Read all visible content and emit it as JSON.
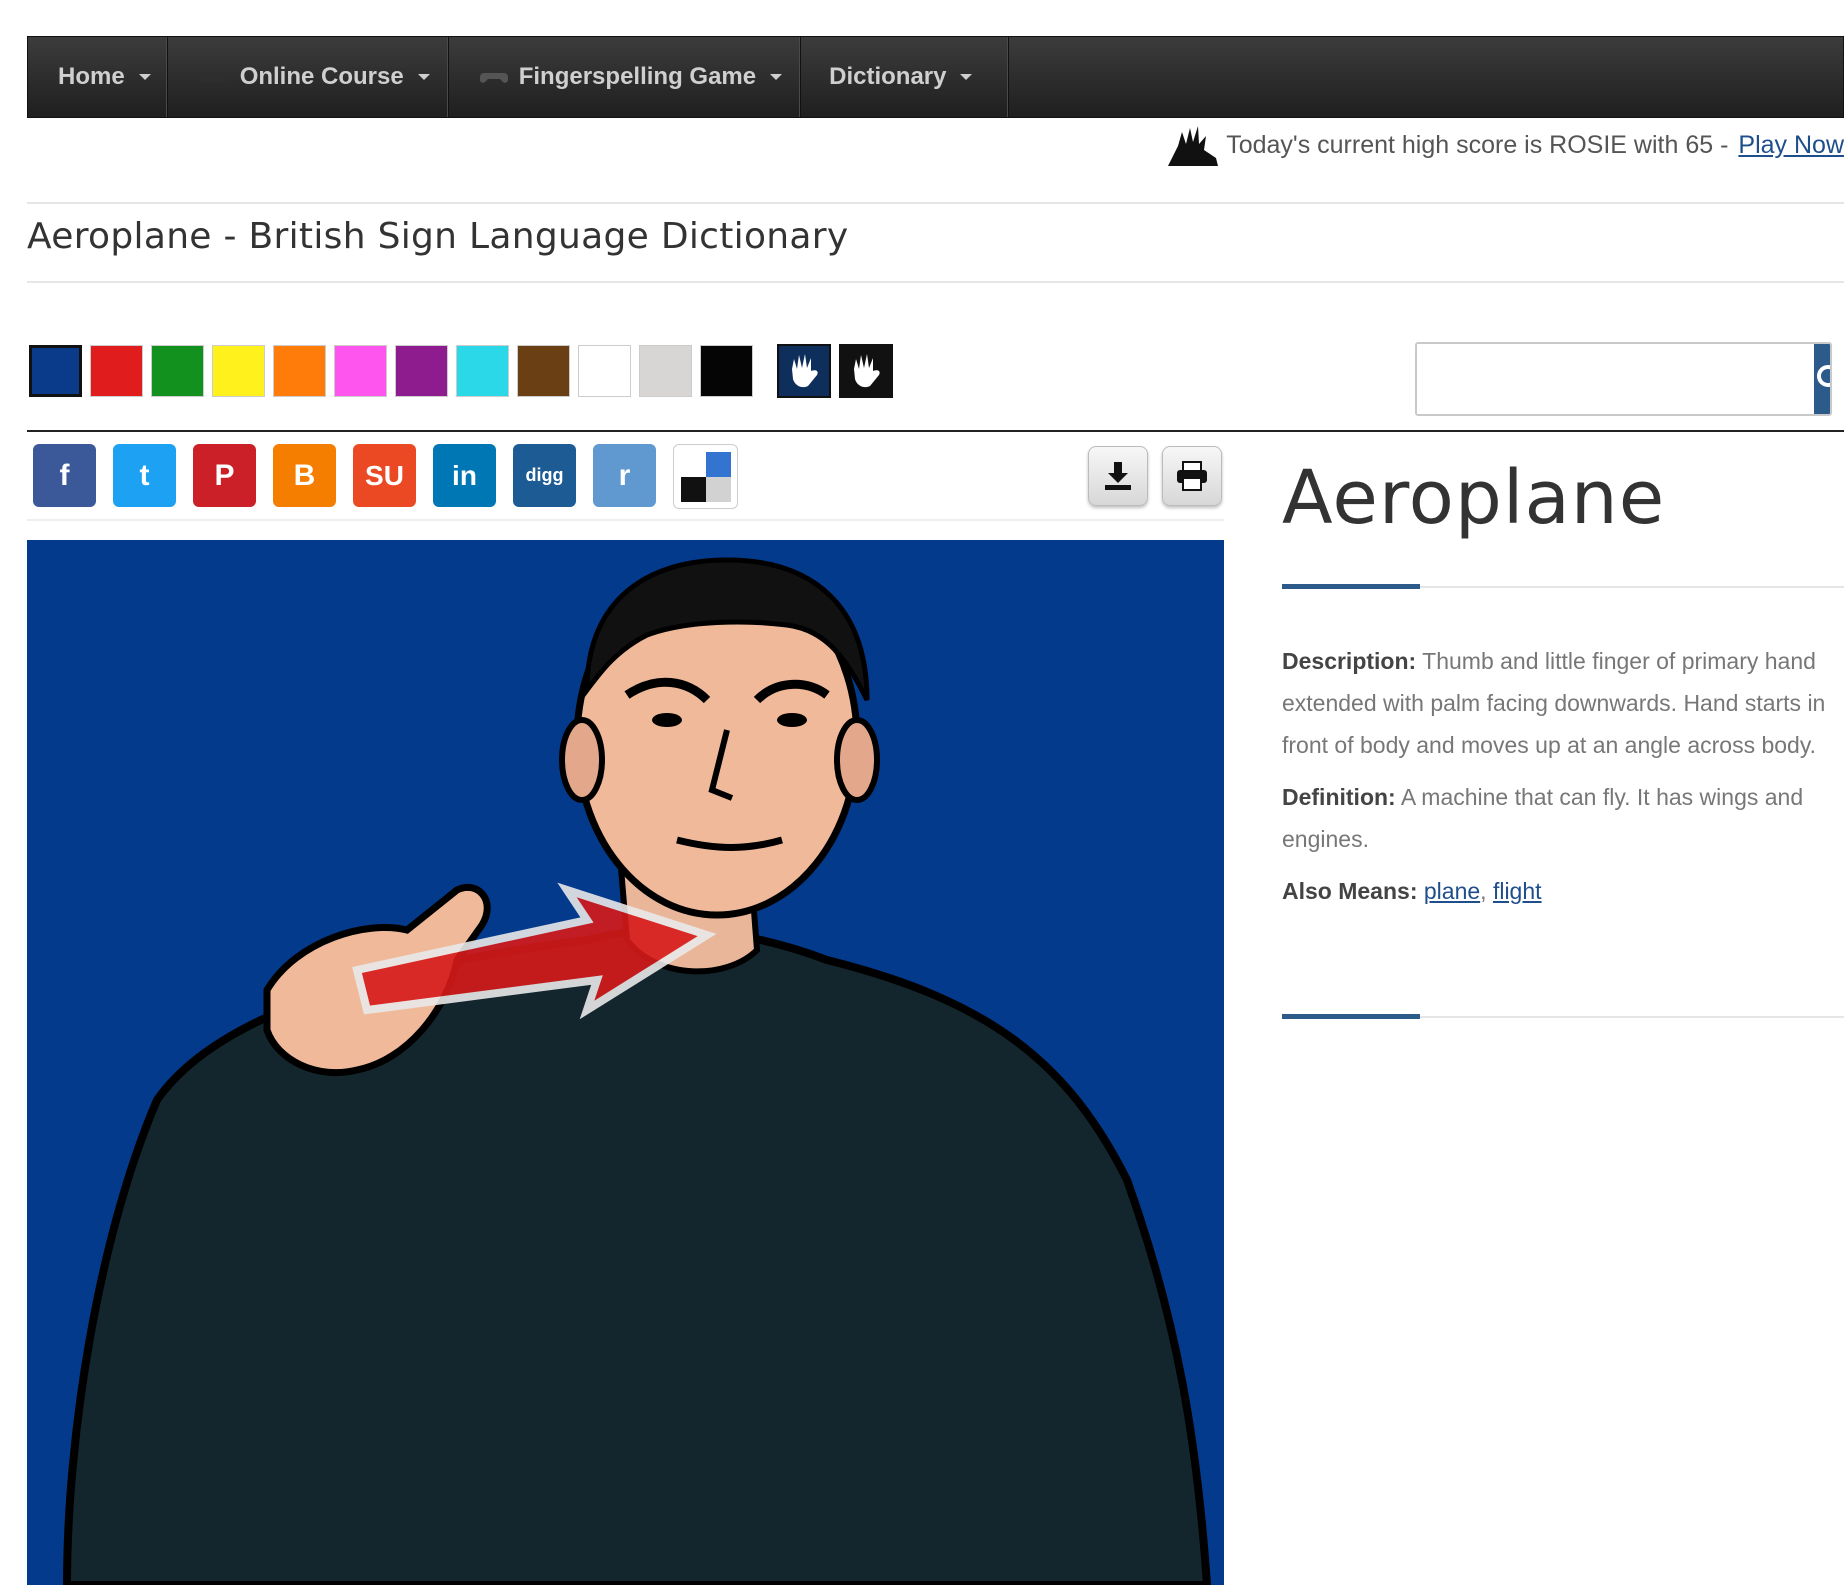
{
  "navbar": {
    "items": [
      {
        "label": "Home",
        "icon": ""
      },
      {
        "label": "Online Course",
        "icon": "course-icon"
      },
      {
        "label": "Fingerspelling Game",
        "icon": "gamepad-icon"
      },
      {
        "label": "Dictionary",
        "icon": ""
      }
    ]
  },
  "highscore": {
    "text": "Today's current high score is ROSIE with 65 -",
    "link": "Play Now"
  },
  "page_title": "Aeroplane - British Sign Language Dictionary",
  "swatches": {
    "colors": [
      "#0a3a8a",
      "#e01c1c",
      "#12911f",
      "#fff21c",
      "#ff7c0a",
      "#ff55ef",
      "#8e1c8e",
      "#2ad8e8",
      "#6b3f14",
      "#ffffff",
      "#d8d6d4",
      "#050505"
    ],
    "selected_index": 0
  },
  "search": {
    "value": "",
    "placeholder": ""
  },
  "share": {
    "buttons": [
      {
        "name": "facebook",
        "glyph": "f",
        "color": "#3b5998"
      },
      {
        "name": "twitter",
        "glyph": "t",
        "color": "#1da1f2"
      },
      {
        "name": "pinterest",
        "glyph": "P",
        "color": "#cb2027"
      },
      {
        "name": "blogger",
        "glyph": "B",
        "color": "#f57d00"
      },
      {
        "name": "stumbleupon",
        "glyph": "SU",
        "color": "#eb4924"
      },
      {
        "name": "linkedin",
        "glyph": "in",
        "color": "#0077b5"
      },
      {
        "name": "digg",
        "glyph": "digg",
        "color": "#1d5b94"
      },
      {
        "name": "reddit",
        "glyph": "r",
        "color": "#5f99cf"
      },
      {
        "name": "delicious",
        "glyph": "",
        "color": "#ffffff"
      }
    ]
  },
  "word": {
    "title": "Aeroplane",
    "description_label": "Description:",
    "description": "Thumb and little finger of primary hand extended with palm facing downwards. Hand starts in front of body and moves up at an angle across body.",
    "definition_label": "Definition:",
    "definition": "A machine that can fly. It has wings and engines.",
    "also_means_label": "Also Means:",
    "also_means": [
      "plane",
      "flight"
    ],
    "also_means_separator": ","
  }
}
